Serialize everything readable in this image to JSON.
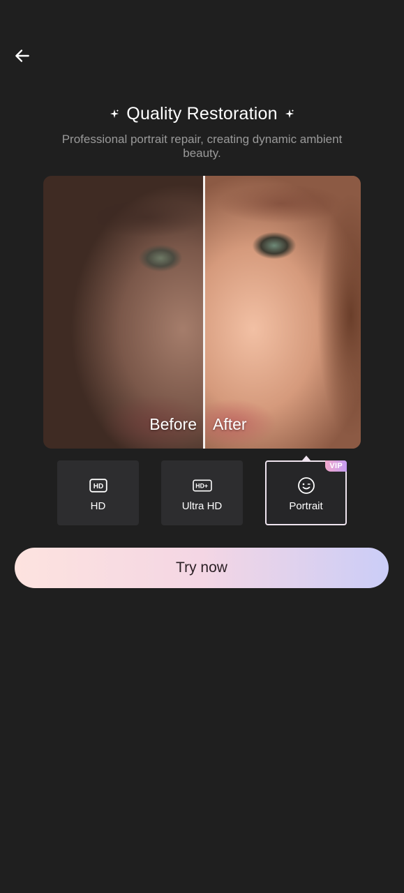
{
  "header": {
    "back_icon": "arrow-left-icon",
    "title": "Quality Restoration",
    "title_decoration_icon": "sparkle-icon",
    "subtitle": "Professional portrait repair, creating dynamic ambient beauty."
  },
  "comparison": {
    "before_label": "Before",
    "after_label": "After",
    "divider_position": 0.505
  },
  "options": [
    {
      "id": "hd",
      "label": "HD",
      "icon": "hd-icon",
      "selected": false
    },
    {
      "id": "ultra-hd",
      "label": "Ultra HD",
      "icon": "hd-plus-icon",
      "selected": false
    },
    {
      "id": "portrait",
      "label": "Portrait",
      "icon": "smile-face-icon",
      "selected": true,
      "badge": "VIP"
    }
  ],
  "cta": {
    "label": "Try now"
  },
  "colors": {
    "background": "#1f1f1f",
    "option_bg": "#2d2d2f",
    "selected_border": "#efe4ef",
    "cta_gradient_start": "#fde3df",
    "cta_gradient_end": "#cbcdf7",
    "vip_gradient_start": "#f2a8cc",
    "vip_gradient_end": "#c49cf0"
  }
}
